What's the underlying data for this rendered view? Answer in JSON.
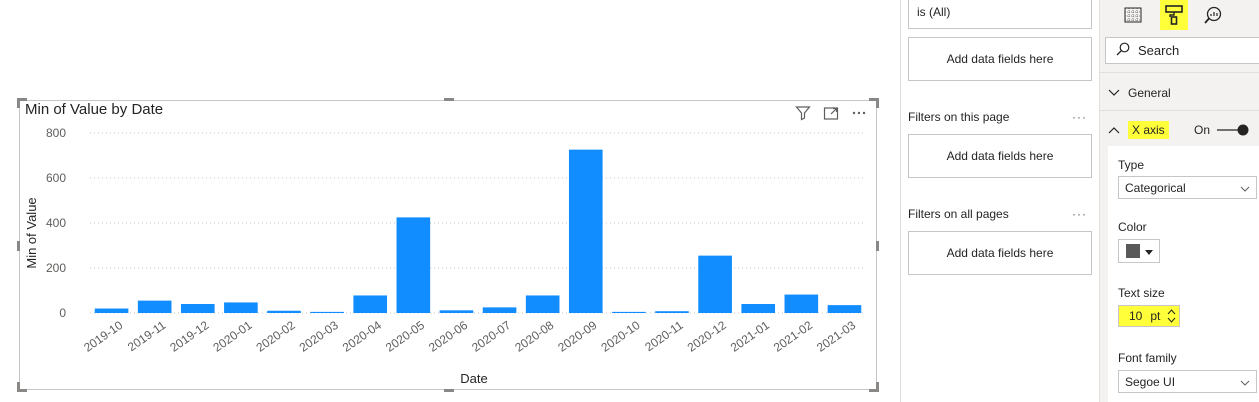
{
  "chart_data": {
    "type": "bar",
    "title": "Min of Value by Date",
    "xlabel": "Date",
    "ylabel": "Min of Value",
    "ylim": [
      0,
      800
    ],
    "yticks": [
      0,
      200,
      400,
      600,
      800
    ],
    "grid": true,
    "color": "#118dff",
    "categories": [
      "2019-10",
      "2019-11",
      "2019-12",
      "2020-01",
      "2020-02",
      "2020-03",
      "2020-04",
      "2020-05",
      "2020-06",
      "2020-07",
      "2020-08",
      "2020-09",
      "2020-10",
      "2020-11",
      "2020-12",
      "2021-01",
      "2021-02",
      "2021-03"
    ],
    "values": [
      20,
      55,
      40,
      47,
      10,
      5,
      78,
      425,
      12,
      25,
      78,
      726,
      5,
      8,
      255,
      40,
      82,
      35
    ]
  },
  "filters": {
    "top_card_value": "is (All)",
    "add_fields_label": "Add data fields here",
    "page_section": "Filters on this page",
    "all_section": "Filters on all pages",
    "more": "···"
  },
  "format_pane": {
    "search_placeholder": "Search",
    "general_label": "General",
    "xaxis_label": "X axis",
    "toggle_label": "On",
    "type_label": "Type",
    "type_value": "Categorical",
    "color_label": "Color",
    "color_value": "#595959",
    "text_size_label": "Text size",
    "text_size_value": "10",
    "text_size_unit": "pt",
    "font_family_label": "Font family",
    "font_family_value": "Segoe UI"
  }
}
